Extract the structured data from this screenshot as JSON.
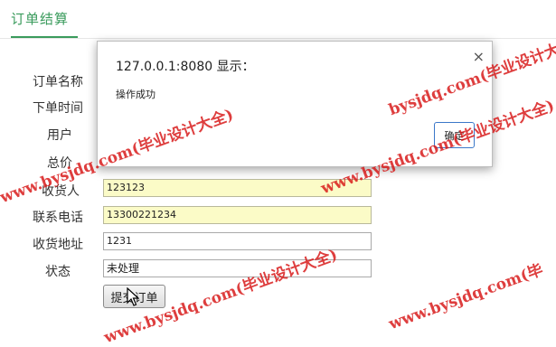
{
  "page": {
    "tab_title": "订单结算"
  },
  "form": {
    "order_name_label": "订单名称",
    "order_time_label": "下单时间",
    "user_label": "用户",
    "total_label": "总价",
    "receiver_label": "收货人",
    "receiver_value": "123123",
    "phone_label": "联系电话",
    "phone_value": "13300221234",
    "address_label": "收货地址",
    "address_value": "1231",
    "status_label": "状态",
    "status_value": "未处理",
    "submit_label": "提交订单"
  },
  "dialog": {
    "title": "127.0.0.1:8080 显示：",
    "message": "操作成功",
    "ok_label": "确定",
    "close_symbol": "×"
  },
  "watermark": {
    "text": "www.bysjdq.com(毕业设计大全)",
    "short": "www.bysjdq.com(毕",
    "tail": "bysjdq.com(毕业设计大全)"
  },
  "colors": {
    "accent": "#3a9b5c",
    "autofill": "#fbfbc7",
    "watermark": "#d71414",
    "dialog_button_border": "#3b78c9"
  }
}
